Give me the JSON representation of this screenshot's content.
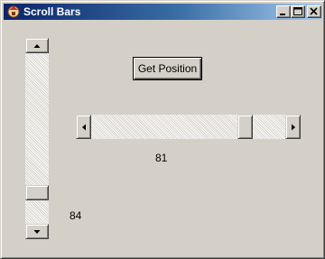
{
  "window": {
    "title": "Scroll Bars"
  },
  "titlebar_buttons": [
    "minimize",
    "maximize",
    "close"
  ],
  "buttons": {
    "get_position": "Get Position"
  },
  "horizontal_scrollbar": {
    "position_fraction": 0.83
  },
  "vertical_scrollbar": {
    "position_fraction": 0.86
  },
  "labels": {
    "horizontal_value": "81",
    "vertical_value": "84"
  },
  "icons": [
    "app-icon",
    "minimize-icon",
    "maximize-icon",
    "close-icon",
    "arrow-up-icon",
    "arrow-down-icon",
    "arrow-left-icon",
    "arrow-right-icon"
  ],
  "colors": {
    "titlebar_start": "#0a246a",
    "titlebar_end": "#a6caf0",
    "face": "#d4d0c8"
  }
}
